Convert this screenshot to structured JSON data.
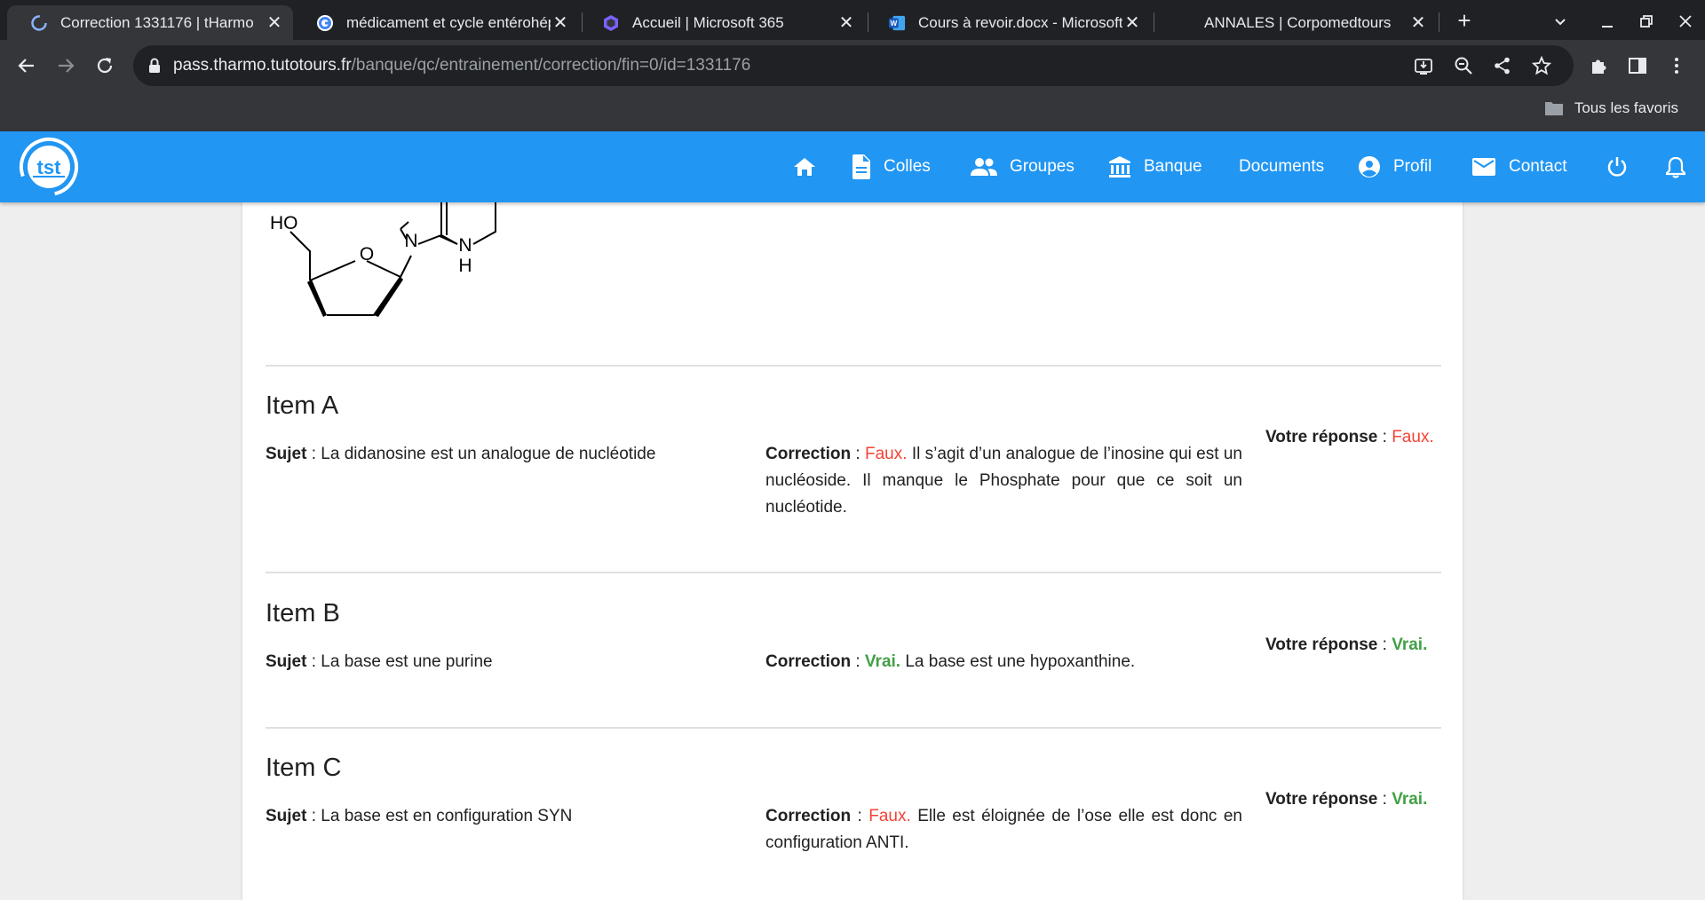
{
  "browser": {
    "tabs": [
      {
        "title": "Correction 1331176 | tHarmo",
        "close": "✕",
        "icon": "tharmo-favicon"
      },
      {
        "title": "médicament et cycle entérohépatique",
        "close": "✕",
        "icon": "google-favicon"
      },
      {
        "title": "Accueil | Microsoft 365",
        "close": "✕",
        "icon": "microsoft365-favicon"
      },
      {
        "title": "Cours à revoir.docx - Microsoft Word",
        "close": "✕",
        "icon": "word-favicon"
      },
      {
        "title": "ANNALES | Corpomedtours",
        "close": "✕",
        "icon": "blank-favicon"
      }
    ],
    "new_tab": "+",
    "url_host": "pass.tharmo.tutotours.fr",
    "url_path": "/banque/qc/entrainement/correction/fin=0/id=1331176",
    "bookmark_folder": "Tous les favoris"
  },
  "site": {
    "logo_text": "tst",
    "nav": [
      {
        "label": "",
        "icon": "home-icon"
      },
      {
        "label": "Colles",
        "icon": "document-icon"
      },
      {
        "label": "Groupes",
        "icon": "people-icon"
      },
      {
        "label": "Banque",
        "icon": "bank-icon"
      },
      {
        "label": "Documents",
        "icon": ""
      },
      {
        "label": "Profil",
        "icon": "account-circle-icon"
      },
      {
        "label": "Contact",
        "icon": "mail-icon"
      },
      {
        "label": "",
        "icon": "power-icon"
      },
      {
        "label": "",
        "icon": "bell-icon"
      }
    ]
  },
  "molecule": {
    "labels": {
      "ho": "HO",
      "o": "O",
      "n": "N",
      "nh_n": "N",
      "nh_h": "H"
    }
  },
  "labels": {
    "subject": "Sujet",
    "correction": "Correction",
    "answer": "Votre réponse",
    "separator": " : "
  },
  "items": [
    {
      "title": "Item A",
      "subject": "La didanosine est un analogue de nucléotide",
      "correction_verdict": "Faux.",
      "correction_text": " Il s’agit d’un analogue de l’inosine qui est un nucléoside. Il manque le Phosphate pour que ce soit un nucléotide.",
      "answer": "Faux."
    },
    {
      "title": "Item B",
      "subject": "La base est une purine",
      "correction_verdict": "Vrai.",
      "correction_text": " La base est une hypoxanthine.",
      "answer": "Vrai."
    },
    {
      "title": "Item C",
      "subject": "La base est en configuration SYN",
      "correction_verdict": "Faux.",
      "correction_text": " Elle est éloignée de l’ose elle est donc en configuration ANTI.",
      "answer": "Vrai."
    }
  ],
  "colors": {
    "header": "#2196f3",
    "false": "#f44336",
    "true": "#43a047"
  }
}
